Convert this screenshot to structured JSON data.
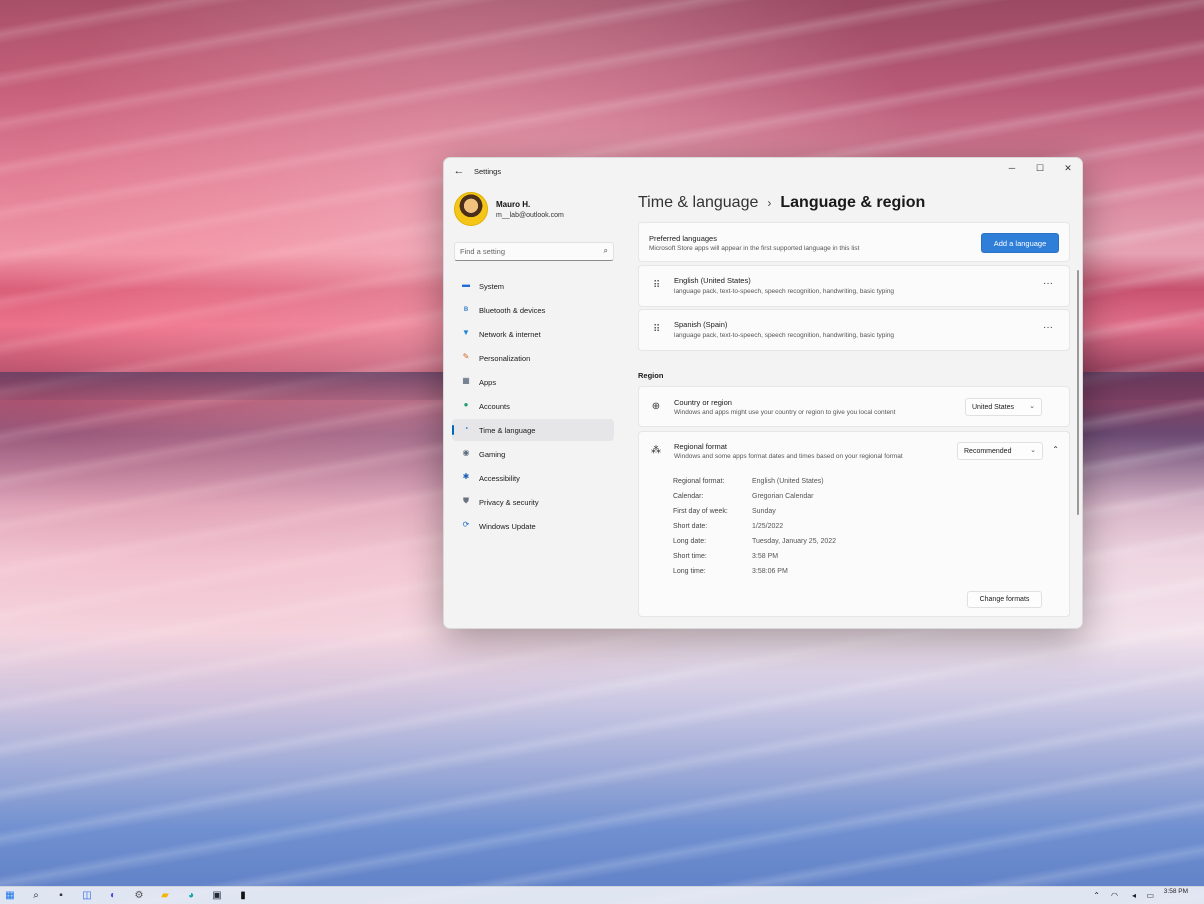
{
  "window": {
    "title": "Settings",
    "back_glyph": "←",
    "minimize_glyph": "─",
    "maximize_glyph": "☐",
    "close_glyph": "✕"
  },
  "profile": {
    "name": "Mauro H.",
    "email": "m__lab@outlook.com"
  },
  "search": {
    "placeholder": "Find a setting",
    "icon": "search-icon"
  },
  "sidebar": {
    "items": [
      {
        "label": "System",
        "icon": "system-icon",
        "glyph": "▬",
        "color": "#1e6fd9",
        "active": false
      },
      {
        "label": "Bluetooth & devices",
        "icon": "bluetooth-icon",
        "glyph": "ʙ",
        "color": "#0a66c2",
        "active": false
      },
      {
        "label": "Network & internet",
        "icon": "wifi-icon",
        "glyph": "▼",
        "color": "#1b87d6",
        "active": false
      },
      {
        "label": "Personalization",
        "icon": "brush-icon",
        "glyph": "✎",
        "color": "#d4661f",
        "active": false
      },
      {
        "label": "Apps",
        "icon": "apps-icon",
        "glyph": "▦",
        "color": "#4a5a72",
        "active": false
      },
      {
        "label": "Accounts",
        "icon": "account-icon",
        "glyph": "●",
        "color": "#1f9e6e",
        "active": false
      },
      {
        "label": "Time & language",
        "icon": "globe-clock-icon",
        "glyph": "◔",
        "color": "#1d7fd1",
        "active": true
      },
      {
        "label": "Gaming",
        "icon": "gamepad-icon",
        "glyph": "◉",
        "color": "#5d6b7e",
        "active": false
      },
      {
        "label": "Accessibility",
        "icon": "accessibility-icon",
        "glyph": "✱",
        "color": "#1a5fb4",
        "active": false
      },
      {
        "label": "Privacy & security",
        "icon": "shield-icon",
        "glyph": "⛊",
        "color": "#6b7280",
        "active": false
      },
      {
        "label": "Windows Update",
        "icon": "update-icon",
        "glyph": "⟳",
        "color": "#1d6fc9",
        "active": false
      }
    ]
  },
  "breadcrumb": {
    "parent": "Time & language",
    "separator": "›",
    "current": "Language & region"
  },
  "preferred": {
    "title": "Preferred languages",
    "description": "Microsoft Store apps will appear in the first supported language in this list",
    "add_button": "Add a language"
  },
  "languages": [
    {
      "name": "English (United States)",
      "features": "language pack, text-to-speech, speech recognition, handwriting, basic typing"
    },
    {
      "name": "Spanish (Spain)",
      "features": "language pack, text-to-speech, speech recognition, handwriting, basic typing"
    }
  ],
  "region": {
    "section_label": "Region",
    "country": {
      "title": "Country or region",
      "description": "Windows and apps might use your country or region to give you local content",
      "value": "United States"
    },
    "format": {
      "title": "Regional format",
      "description": "Windows and some apps format dates and times based on your regional format",
      "value": "Recommended",
      "rows": [
        {
          "key": "Regional format:",
          "value": "English (United States)"
        },
        {
          "key": "Calendar:",
          "value": "Gregorian Calendar"
        },
        {
          "key": "First day of week:",
          "value": "Sunday"
        },
        {
          "key": "Short date:",
          "value": "1/25/2022"
        },
        {
          "key": "Long date:",
          "value": "Tuesday, January 25, 2022"
        },
        {
          "key": "Short time:",
          "value": "3:58 PM"
        },
        {
          "key": "Long time:",
          "value": "3:58:06 PM"
        }
      ],
      "change_button": "Change formats"
    }
  },
  "glyphs": {
    "more": "···",
    "grip": "⠿",
    "chevron_down": "⌄",
    "chevron_up": "⌃"
  },
  "taskbar": {
    "clock_time": "3:58 PM"
  }
}
